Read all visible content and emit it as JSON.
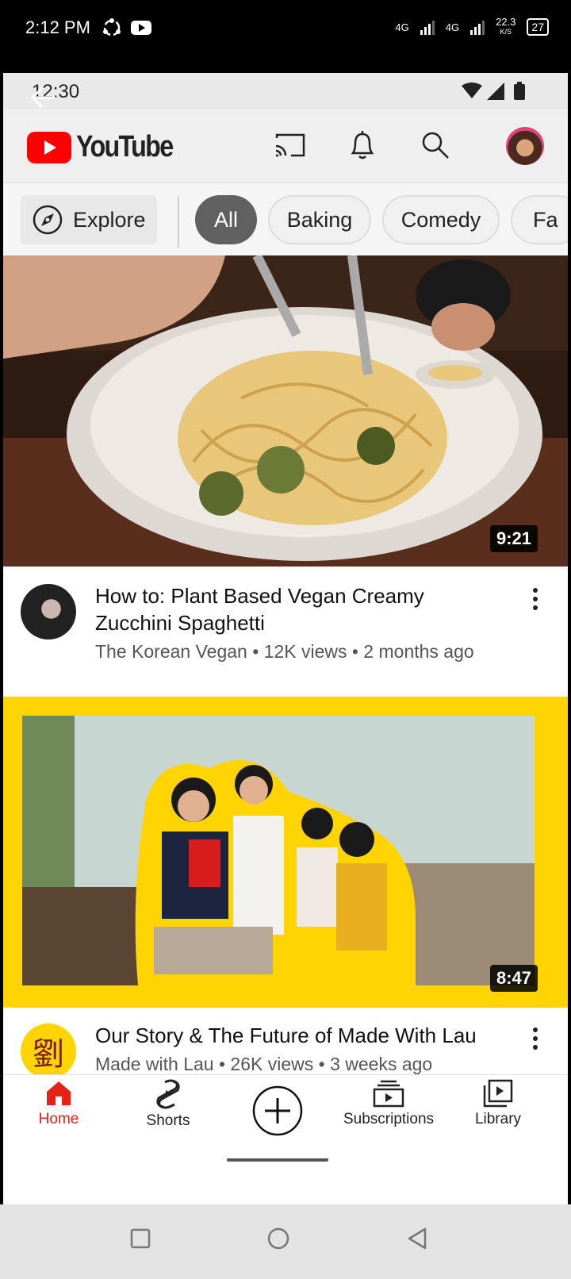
{
  "outer_status": {
    "time": "2:12 PM",
    "net1": "4G",
    "net2": "4G",
    "speed_value": "22.3",
    "speed_unit": "K/S",
    "battery": "27"
  },
  "inner_status": {
    "time": "12:30"
  },
  "header": {
    "app_name": "YouTube"
  },
  "chips": {
    "explore": "Explore",
    "items": [
      "All",
      "Baking",
      "Comedy",
      "Fa"
    ]
  },
  "videos": [
    {
      "title_line1": "How to: Plant Based Vegan Creamy",
      "title_line2": "Zucchini Spaghetti",
      "meta": "The Korean Vegan • 12K views • 2 months ago",
      "duration": "9:21"
    },
    {
      "title_line1": "Our Story & The Future of Made With Lau",
      "meta": "Made with Lau • 26K views • 3 weeks ago",
      "duration": "8:47",
      "channel_glyph": "劉"
    }
  ],
  "nav": {
    "home": "Home",
    "shorts": "Shorts",
    "subscriptions": "Subscriptions",
    "library": "Library"
  },
  "colors": {
    "accent": "#ff0000",
    "home_active": "#e62117",
    "chip_selected": "#606060",
    "thumb_border": "#ffd400"
  }
}
